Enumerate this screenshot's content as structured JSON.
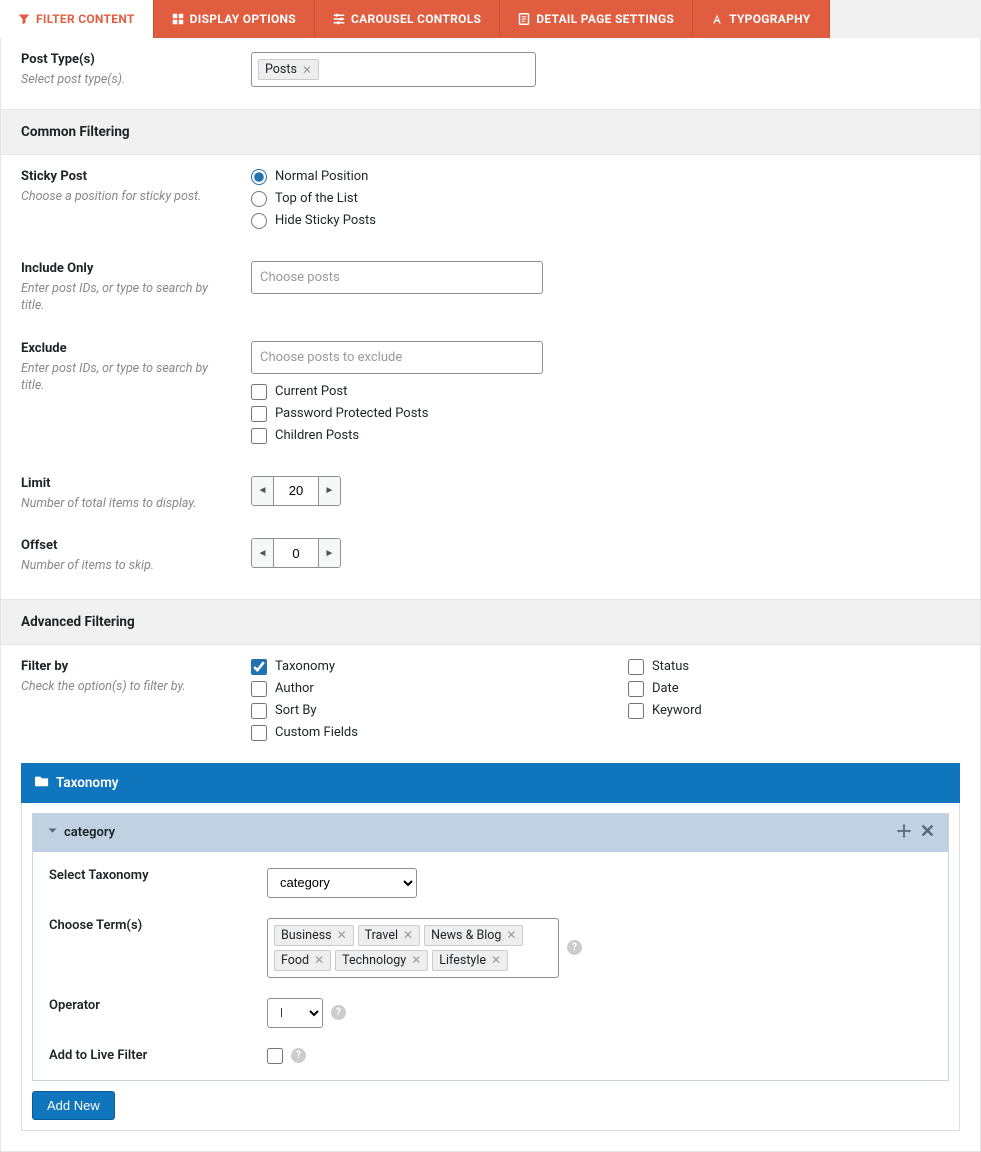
{
  "tabs": {
    "filter_content": "FILTER CONTENT",
    "display_options": "DISPLAY OPTIONS",
    "carousel_controls": "CAROUSEL CONTROLS",
    "detail_page_settings": "DETAIL PAGE SETTINGS",
    "typography": "TYPOGRAPHY"
  },
  "post_type": {
    "label": "Post Type(s)",
    "help": "Select post type(s).",
    "tag": "Posts"
  },
  "common_filtering": {
    "heading": "Common Filtering",
    "sticky": {
      "label": "Sticky Post",
      "help": "Choose a position for sticky post.",
      "options": {
        "normal": "Normal Position",
        "top": "Top of the List",
        "hide": "Hide Sticky Posts"
      }
    },
    "include": {
      "label": "Include Only",
      "help": "Enter post IDs, or type to search by title.",
      "placeholder": "Choose posts"
    },
    "exclude": {
      "label": "Exclude",
      "help": "Enter post IDs, or type to search by title.",
      "placeholder": "Choose posts to exclude",
      "current_post": "Current Post",
      "password": "Password Protected Posts",
      "children": "Children Posts"
    },
    "limit": {
      "label": "Limit",
      "help": "Number of total items to display.",
      "value": "20"
    },
    "offset": {
      "label": "Offset",
      "help": "Number of items to skip.",
      "value": "0"
    }
  },
  "advanced_filtering": {
    "heading": "Advanced Filtering",
    "filter_by": {
      "label": "Filter by",
      "help": "Check the option(s) to filter by.",
      "col1": {
        "taxonomy": "Taxonomy",
        "author": "Author",
        "sort_by": "Sort By",
        "custom_fields": "Custom Fields"
      },
      "col2": {
        "status": "Status",
        "date": "Date",
        "keyword": "Keyword"
      }
    }
  },
  "taxonomy_panel": {
    "title": "Taxonomy",
    "group_title": "category",
    "select_taxonomy": {
      "label": "Select Taxonomy",
      "value": "category"
    },
    "choose_terms": {
      "label": "Choose Term(s)",
      "tags": [
        "Business",
        "Travel",
        "News & Blog",
        "Food",
        "Technology",
        "Lifestyle"
      ]
    },
    "operator": {
      "label": "Operator",
      "value": "IN"
    },
    "live_filter": {
      "label": "Add to Live Filter"
    },
    "add_new": "Add New"
  }
}
